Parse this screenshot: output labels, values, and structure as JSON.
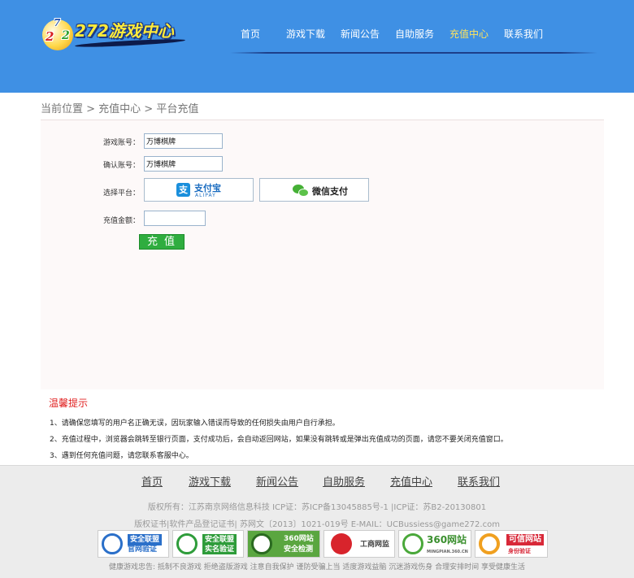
{
  "header": {
    "logo": {
      "digits": [
        "2",
        "7",
        "2"
      ],
      "text": "272游戏中心"
    },
    "nav": [
      {
        "label": "首页",
        "active": false
      },
      {
        "label": "游戏下载",
        "active": false
      },
      {
        "label": "新闻公告",
        "active": false
      },
      {
        "label": "自助服务",
        "active": false
      },
      {
        "label": "充值中心",
        "active": true
      },
      {
        "label": "联系我们",
        "active": false
      }
    ]
  },
  "breadcrumb": "当前位置 > 充值中心 > 平台充值",
  "form": {
    "account_label": "游戏账号：",
    "account_value": "万博棋牌",
    "confirm_label": "确认账号：",
    "confirm_value": "万博棋牌",
    "platform_label": "选择平台：",
    "alipay": {
      "icon": "支",
      "label": "支付宝",
      "sub": "ALIPAY"
    },
    "wechat": {
      "label": "微信支付"
    },
    "amount_label": "充值金额：",
    "amount_value": "",
    "submit_label": "充值"
  },
  "tips": {
    "title": "温馨提示",
    "items": [
      "1、请确保您填写的用户名正确无误，因玩家输入错误而导致的任何损失由用户自行承担。",
      "2、充值过程中，浏览器会跳转至银行页面，支付成功后，会自动返回网站，如果没有跳转或是弹出充值成功的页面，请您不要关闭充值窗口。",
      "3、遇到任何充值问题，请您联系客服中心。"
    ]
  },
  "footer": {
    "nav": [
      "首页",
      "游戏下载",
      "新闻公告",
      "自助服务",
      "充值中心",
      "联系我们"
    ],
    "copyright_line1": "版权所有：江苏南京网络信息科技    ICP证：苏ICP备13045885号-1 |ICP证：苏B2-20130801",
    "copyright_line2": "版权证书|软件产品登记证书| 苏网文〔2013〕1021-019号    E-MAIL：UCBussiess@game272.com",
    "badges": [
      {
        "line1": "安全联盟",
        "line2": "官网验证"
      },
      {
        "line1": "安全联盟",
        "line2": "实名验证"
      },
      {
        "line1": "360网站",
        "line2": "安全检测"
      },
      {
        "line1": "工商网监",
        "line2": ""
      },
      {
        "line1": "360网站",
        "line2": "MINGPIAN.360.CN"
      },
      {
        "line1": "可信网站",
        "line2": "身份验证"
      }
    ],
    "health": "健康游戏忠告: 抵制不良游戏   拒绝盗版游戏   注意自我保护   谨防受骗上当   适度游戏益脑   沉迷游戏伤身   合理安排时间   享受健康生活"
  },
  "colors": {
    "header_bg": "#3f90e4",
    "nav_active": "#ffe45c",
    "tips_title": "#e02020",
    "submit_bg": "#2fad3f"
  }
}
